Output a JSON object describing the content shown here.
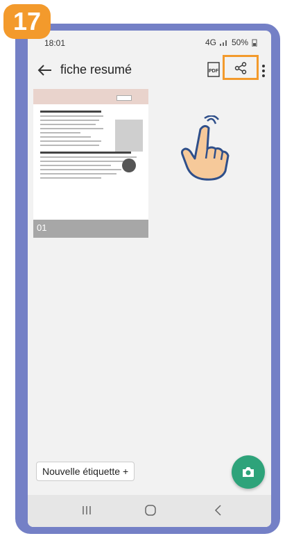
{
  "step": {
    "number": "17"
  },
  "status": {
    "time": "18:01",
    "network": "4G",
    "battery": "50%"
  },
  "app_bar": {
    "title": "fiche resumé",
    "pdf_icon": "pdf-icon",
    "share_icon": "share-icon",
    "menu_icon": "more-vertical-icon"
  },
  "document": {
    "page_number": "01"
  },
  "label_button": {
    "text": "Nouvelle étiquette +"
  },
  "fab": {
    "icon": "camera-icon",
    "color": "#2ea37a"
  },
  "colors": {
    "frame": "#7480c6",
    "highlight": "#f39a2c"
  }
}
